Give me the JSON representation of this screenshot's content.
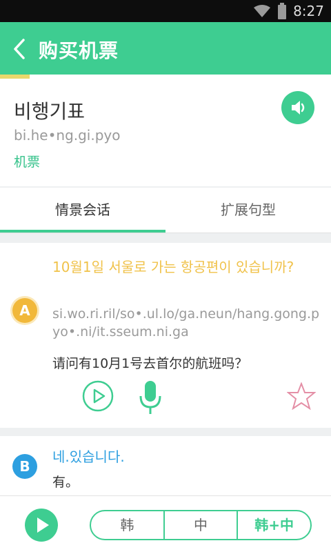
{
  "status_bar": {
    "time": "8:27",
    "icons": [
      "wifi-icon",
      "battery-icon"
    ]
  },
  "header": {
    "title": "购买机票",
    "back_icon": "chevron-left-icon",
    "progress": 0.09
  },
  "word": {
    "korean": "비행기표",
    "romanization": "bi.he•ng.gi.pyo",
    "chinese": "机票",
    "speaker_icon": "speaker-icon"
  },
  "tabs": [
    {
      "label": "情景会话",
      "active": true
    },
    {
      "label": "扩展句型",
      "active": false
    }
  ],
  "dialogs": [
    {
      "speaker": "A",
      "korean": "10월1일 서울로 가는 항공편이 있습니까?",
      "romanization": "si.wo.ri.ril/so•.ul.lo/ga.neun/hang.gong.pyo•.ni/it.sseum.ni.ga",
      "chinese": "请问有10月1号去首尔的航班吗？",
      "icons": [
        "play-circle-icon",
        "microphone-icon",
        "star-outline-icon"
      ]
    },
    {
      "speaker": "B",
      "korean": "네.있습니다.",
      "chinese": "有。"
    }
  ],
  "bottom": {
    "play_icon": "play-icon",
    "modes": [
      "韩",
      "中",
      "韩+中"
    ],
    "active_mode": "韩+中"
  },
  "colors": {
    "primary": "#3ecd91",
    "speaker_a": "#f1b83a",
    "speaker_b": "#2d9fe0",
    "korean_a": "#f0c24a"
  }
}
